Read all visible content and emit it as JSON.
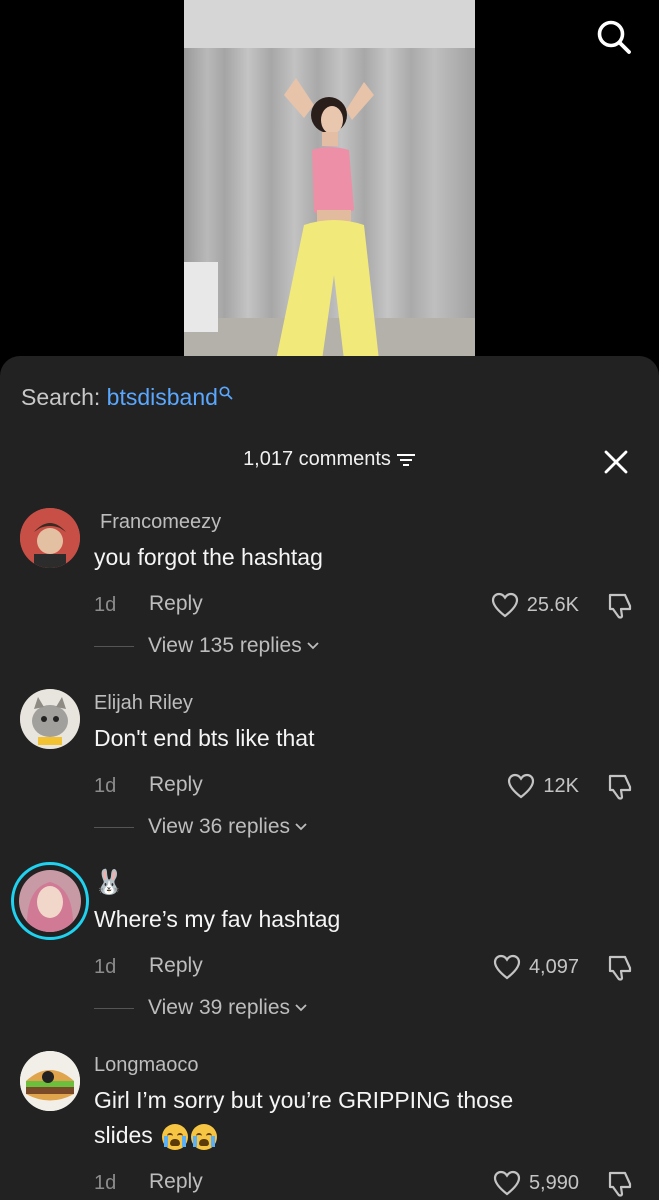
{
  "search": {
    "label": "Search:",
    "query": "btsdisband"
  },
  "comments_header": {
    "count_label": "1,017 comments"
  },
  "comments": [
    {
      "username": "Francomeezy",
      "text": "you forgot the hashtag",
      "age": "1d",
      "reply_label": "Reply",
      "likes": "25.6K",
      "view_replies": "View 135 replies"
    },
    {
      "username": "Elijah Riley",
      "text": "Don't end bts like that",
      "age": "1d",
      "reply_label": "Reply",
      "likes": "12K",
      "view_replies": "View 36 replies"
    },
    {
      "username": "🐰",
      "text": "Where’s my fav hashtag",
      "age": "1d",
      "reply_label": "Reply",
      "likes": "4,097",
      "view_replies": "View 39 replies"
    },
    {
      "username": "Longmaoco",
      "text_line1": "Girl I’m sorry but you’re GRIPPING those",
      "text_line2": "slides",
      "age": "1d",
      "reply_label": "Reply",
      "likes": "5,990"
    }
  ],
  "icons": {
    "search": "search-icon",
    "filter": "filter-icon",
    "close": "close-icon",
    "like": "heart-icon",
    "dislike": "dislike-icon",
    "chevron": "chevron-down-icon",
    "emoji": "loudly-crying-face-icon"
  },
  "colors": {
    "accent": "#5aa7ff",
    "sheet_bg": "#222222",
    "story_ring": "#1ed2f0"
  }
}
